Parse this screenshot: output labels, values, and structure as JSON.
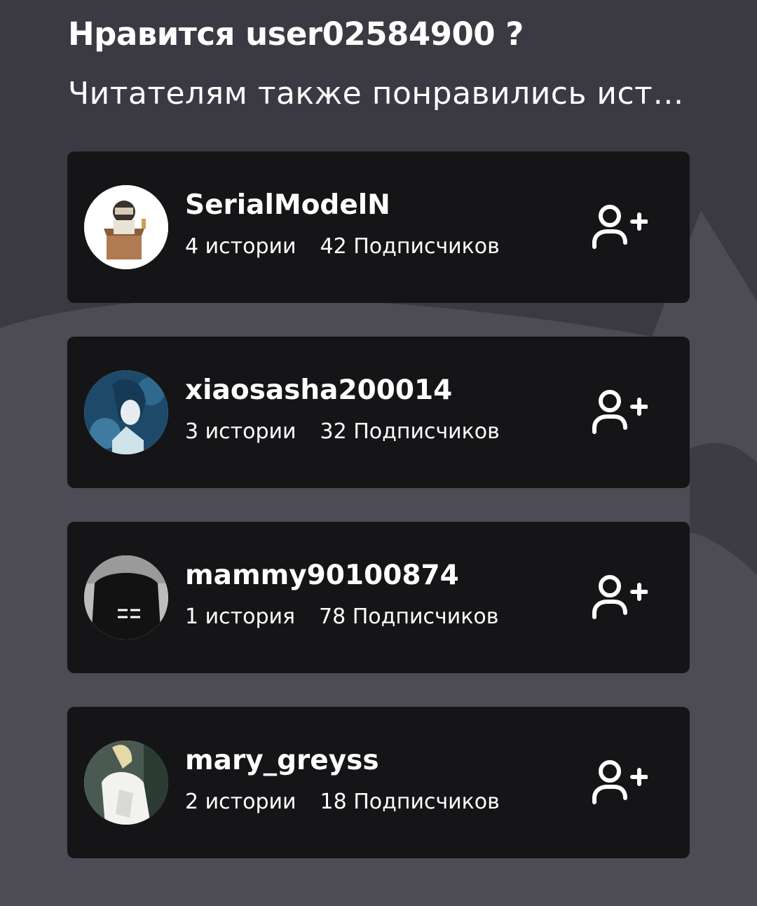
{
  "header": {
    "title": "Нравится user02584900 ?",
    "subtitle": "Читателям также понравились ист…"
  },
  "authors": [
    {
      "username": "SerialModelN",
      "stories": "4 истории",
      "followers": "42 Подписчиков",
      "avatar_icon": "avatar-box-character-icon",
      "follow_icon": "add-user-icon"
    },
    {
      "username": "xiaosasha200014",
      "stories": "3 истории",
      "followers": "32 Подписчиков",
      "avatar_icon": "avatar-anime-character-icon",
      "follow_icon": "add-user-icon"
    },
    {
      "username": "mammy90100874",
      "stories": "1 история",
      "followers": "78 Подписчиков",
      "avatar_icon": "avatar-hoodie-icon",
      "follow_icon": "add-user-icon"
    },
    {
      "username": "mary_greyss",
      "stories": "2 истории",
      "followers": "18 Подписчиков",
      "avatar_icon": "avatar-person-icon",
      "follow_icon": "add-user-icon"
    }
  ],
  "colors": {
    "background": "#3b3a42",
    "card": "#151417",
    "text": "#ffffff"
  }
}
